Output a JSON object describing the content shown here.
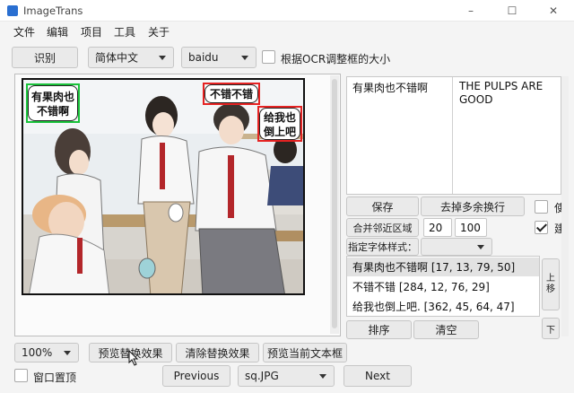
{
  "window": {
    "title": "ImageTrans",
    "minimize_glyph": "–",
    "maximize_glyph": "☐",
    "close_glyph": "✕"
  },
  "menu": [
    "文件",
    "编辑",
    "项目",
    "工具",
    "关于"
  ],
  "toolbar": {
    "recognize_label": "识别",
    "language_value": "简体中文",
    "engine_value": "baidu",
    "resize_by_ocr_label": "根据OCR调整框的大小",
    "resize_by_ocr_checked": false
  },
  "canvas_bubbles": [
    {
      "text_line1": "有果肉也",
      "text_line2": "不错啊",
      "box_color": "#19c23a"
    },
    {
      "text_line1": "不错不错",
      "text_line2": "",
      "box_color": "#e52222"
    },
    {
      "text_line1": "给我也",
      "text_line2": "倒上吧",
      "box_color": "#e52222"
    }
  ],
  "text_editor": {
    "source": "有果肉也不错啊",
    "translation": "THE PULPS ARE GOOD"
  },
  "actions": {
    "save_label": "保存",
    "remove_newlines_label": "去掉多余换行",
    "merge_label": "合并邻近区域",
    "merge_value_1": "20",
    "merge_value_2": "100",
    "font_style_label": "指定字体样式：",
    "font_style_value": "",
    "side_check_1_label": "使",
    "side_check_1_checked": false,
    "side_check_2_label": "建",
    "side_check_2_checked": true
  },
  "regions": [
    {
      "text": "有果肉也不错啊 [17, 13, 79, 50]",
      "selected": true
    },
    {
      "text": "不错不错 [284, 12, 76, 29]",
      "selected": false
    },
    {
      "text": "给我也倒上吧. [362, 45, 64, 47]",
      "selected": false
    }
  ],
  "region_buttons": {
    "move_up": "上移",
    "move_down": "下",
    "sort_label": "排序",
    "clear_label": "清空"
  },
  "bottom": {
    "zoom_value": "100%",
    "preview_replace_label": "预览替换效果",
    "clear_replace_label": "清除替换效果",
    "preview_current_label": "预览当前文本框",
    "pin_window_label": "窗口置顶",
    "pin_window_checked": false,
    "previous_label": "Previous",
    "file_value": "sq.JPG",
    "next_label": "Next"
  },
  "colors": {
    "ocr_green": "#19c23a",
    "ocr_red": "#e52222",
    "accent": "#2a6fd1"
  }
}
